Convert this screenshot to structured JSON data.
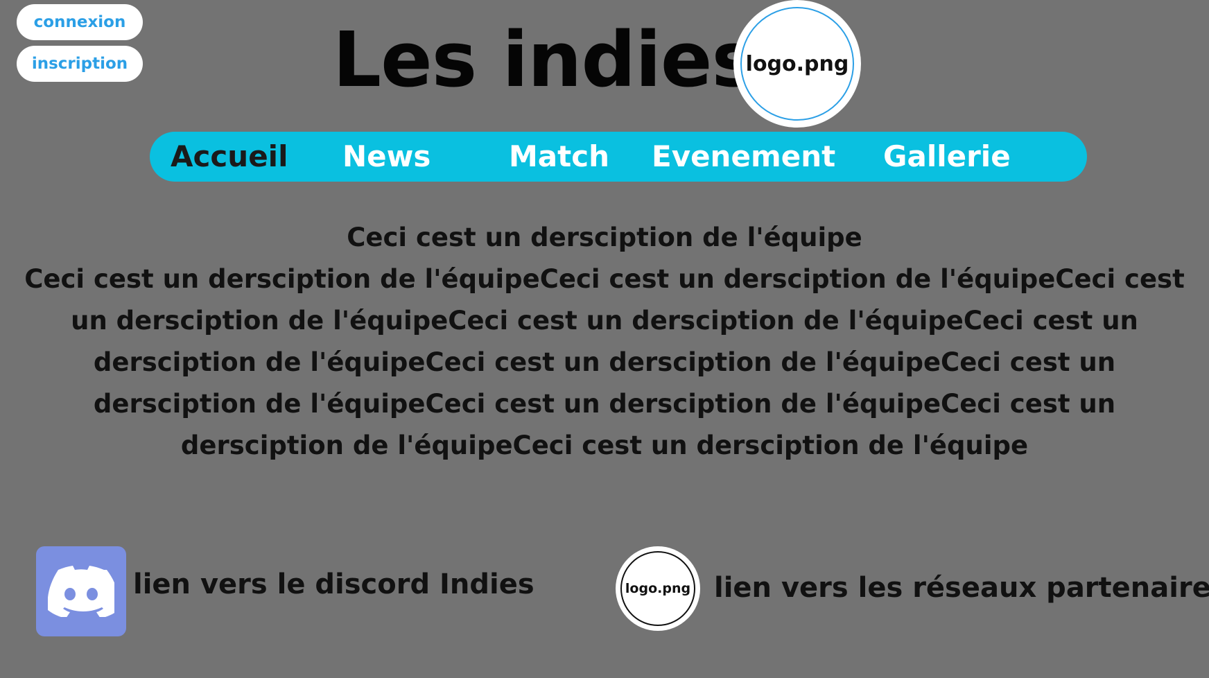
{
  "auth": {
    "login_label": "connexion",
    "signup_label": "inscription"
  },
  "header": {
    "title": "Les indies",
    "logo_text": "logo.png"
  },
  "nav": {
    "items": [
      {
        "label": "Accueil",
        "active": true
      },
      {
        "label": "News",
        "active": false
      },
      {
        "label": "Match",
        "active": false
      },
      {
        "label": "Evenement",
        "active": false
      },
      {
        "label": "Gallerie",
        "active": false
      }
    ]
  },
  "description": {
    "lines": [
      "Ceci cest un dersciption de l'équipe",
      "Ceci cest un dersciption de l'équipeCeci cest un dersciption de l'équipeCeci cest",
      "un dersciption de l'équipeCeci cest un dersciption de l'équipeCeci cest un",
      "dersciption de l'équipeCeci cest un dersciption de l'équipeCeci cest un",
      "dersciption de l'équipeCeci cest un dersciption de l'équipeCeci cest un",
      "dersciption de l'équipeCeci cest un dersciption de l'équipe"
    ]
  },
  "footer": {
    "discord_label": "lien vers le discord Indies",
    "partner_logo_text": "logo.png",
    "partner_label": "lien vers les réseaux partenaire"
  },
  "colors": {
    "background": "#737373",
    "nav_bar": "#0ac0e0",
    "link_blue": "#2b9fe6",
    "discord": "#7b8fe0"
  },
  "icons": {
    "discord": "discord-icon"
  }
}
